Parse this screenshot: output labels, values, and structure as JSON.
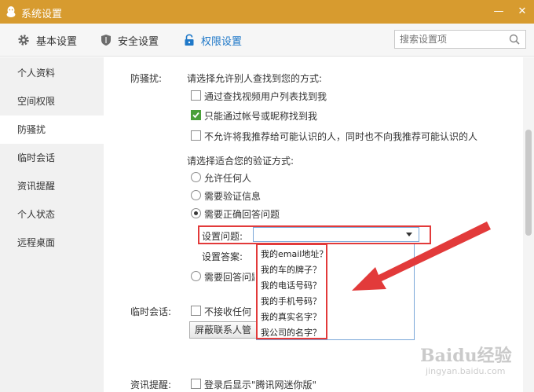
{
  "window": {
    "title": "系统设置",
    "minimize_glyph": "—",
    "close_glyph": "✕"
  },
  "tabs": [
    {
      "label": "基本设置",
      "icon": "gear-icon"
    },
    {
      "label": "安全设置",
      "icon": "shield-icon"
    },
    {
      "label": "权限设置",
      "icon": "lock-icon",
      "active": true
    }
  ],
  "search": {
    "placeholder": "搜索设置项"
  },
  "sidebar": {
    "items": [
      {
        "label": "个人资料"
      },
      {
        "label": "空间权限"
      },
      {
        "label": "防骚扰",
        "active": true
      },
      {
        "label": "临时会话"
      },
      {
        "label": "资讯提醒"
      },
      {
        "label": "个人状态"
      },
      {
        "label": "远程桌面"
      }
    ]
  },
  "anti_harass": {
    "section_label": "防骚扰:",
    "find_prompt": "请选择允许别人查找到您的方式:",
    "find_options": [
      {
        "label": "通过查找视频用户列表找到我",
        "checked": false
      },
      {
        "label": "只能通过帐号或昵称找到我",
        "checked": true
      },
      {
        "label": "不允许将我推荐给可能认识的人，同时也不向我推荐可能认识的人",
        "checked": false
      }
    ],
    "verify_prompt": "请选择适合您的验证方式:",
    "verify_options": [
      {
        "label": "允许任何人",
        "selected": false
      },
      {
        "label": "需要验证信息",
        "selected": false
      },
      {
        "label": "需要正确回答问题",
        "selected": true
      }
    ],
    "question_label": "设置问题:",
    "question_value": "",
    "answer_label": "设置答案:",
    "extra_option_label": "需要回答问题",
    "question_dropdown_options": [
      "我的email地址？",
      "我的车的牌子？",
      "我的电话号码？",
      "我的手机号码？",
      "我的真实名字？",
      "我公司的名字？"
    ]
  },
  "temp_session": {
    "section_label": "临时会话:",
    "checkbox_label": "不接收任何",
    "button_label": "屏蔽联系人管"
  },
  "news": {
    "section_label": "资讯提醒:",
    "checkbox_label": "登录后显示\"腾讯网迷你版\""
  },
  "watermark": {
    "text": "Baidu经验",
    "subtext": "jingyan.baidu.com"
  },
  "colors": {
    "titlebar": "#d79b2f",
    "active_tab": "#1f78c8",
    "highlight": "#e23a3a",
    "check": "#4aa03a"
  }
}
